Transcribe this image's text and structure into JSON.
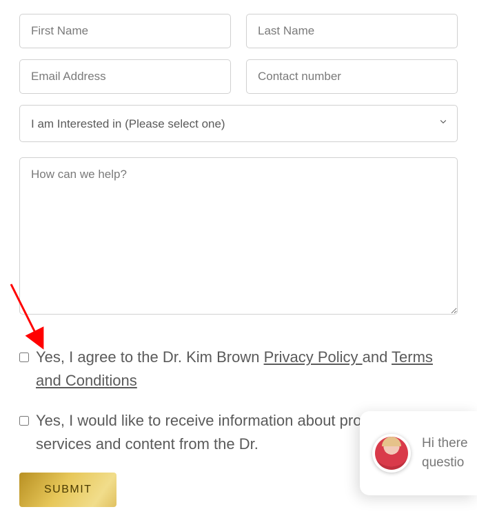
{
  "form": {
    "first_name_placeholder": "First Name",
    "last_name_placeholder": "Last Name",
    "email_placeholder": "Email Address",
    "contact_placeholder": "Contact number",
    "interest_placeholder": "I am Interested in (Please select one)",
    "help_placeholder": "How can we help?",
    "privacy_consent": {
      "prefix": "Yes, I agree to the Dr. Kim Brown ",
      "link1": "Privacy Policy ",
      "middle": "and ",
      "link2": "Terms and Conditions"
    },
    "marketing_consent": "Yes, I would like to receive information about products, services and content from the Dr.",
    "submit_label": "SUBMIT"
  },
  "chat": {
    "line1": "Hi there",
    "line2": "questio"
  }
}
